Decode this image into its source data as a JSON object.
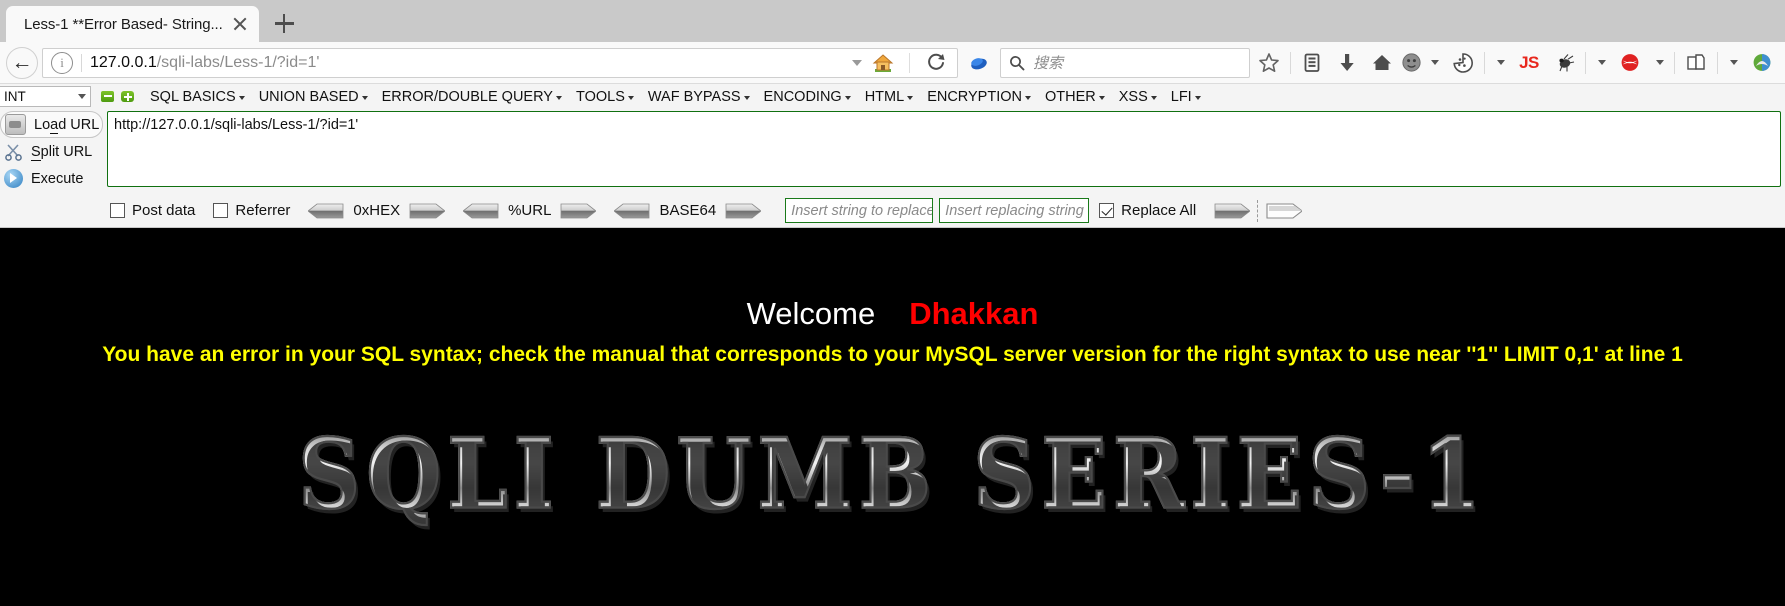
{
  "browser": {
    "tab": {
      "title": "Less-1 **Error Based- String...",
      "close_label": "×"
    },
    "newtab_label": "+",
    "back_label": "←",
    "url": {
      "host": "127.0.0.1",
      "path": "/sqli-labs/Less-1/?id=1'",
      "full": "127.0.0.1/sqli-labs/Less-1/?id=1'"
    },
    "search": {
      "placeholder": "搜索"
    },
    "toolbar_icons": [
      "bookmark-star-icon",
      "library-icon",
      "downloads-icon",
      "home-icon",
      "user-avatar-icon",
      "cookie-manager-icon",
      "js-toggle-icon",
      "firebug-icon",
      "hackbar-icon",
      "tamper-data-icon",
      "noscript-icon"
    ],
    "js_badge": "JS"
  },
  "hackbar": {
    "encoding_select": "INT",
    "menus": [
      "SQL BASICS",
      "UNION BASED",
      "ERROR/DOUBLE QUERY",
      "TOOLS",
      "WAF BYPASS",
      "ENCODING",
      "HTML",
      "ENCRYPTION",
      "OTHER",
      "XSS",
      "LFI"
    ],
    "actions": [
      {
        "label": "Load URL",
        "icon": "load-url-icon"
      },
      {
        "label": "Split URL",
        "icon": "split-url-icon"
      },
      {
        "label": "Execute",
        "icon": "execute-icon"
      }
    ],
    "url_textarea": "http://127.0.0.1/sqli-labs/Less-1/?id=1'",
    "options": {
      "post_data": {
        "label": "Post data",
        "checked": false
      },
      "referrer": {
        "label": "Referrer",
        "checked": false
      },
      "replace_all": {
        "label": "Replace All",
        "checked": true
      }
    },
    "converters": [
      {
        "label": "0xHEX"
      },
      {
        "label": "%URL"
      },
      {
        "label": "BASE64"
      }
    ],
    "replace_inputs": {
      "search_placeholder": "Insert string to replace",
      "replace_placeholder": "Insert replacing string"
    }
  },
  "page": {
    "welcome_text": "Welcome",
    "welcome_name": "Dhakkan",
    "sql_error": "You have an error in your SQL syntax; check the manual that corresponds to your MySQL server version for the right syntax to use near ''1'' LIMIT 0,1' at line 1",
    "logo_text": "SQLI DUMB SERIES-1",
    "colors": {
      "background": "#000000",
      "welcome": "#ffffff",
      "name": "#ff0000",
      "error": "#ffff00"
    }
  }
}
